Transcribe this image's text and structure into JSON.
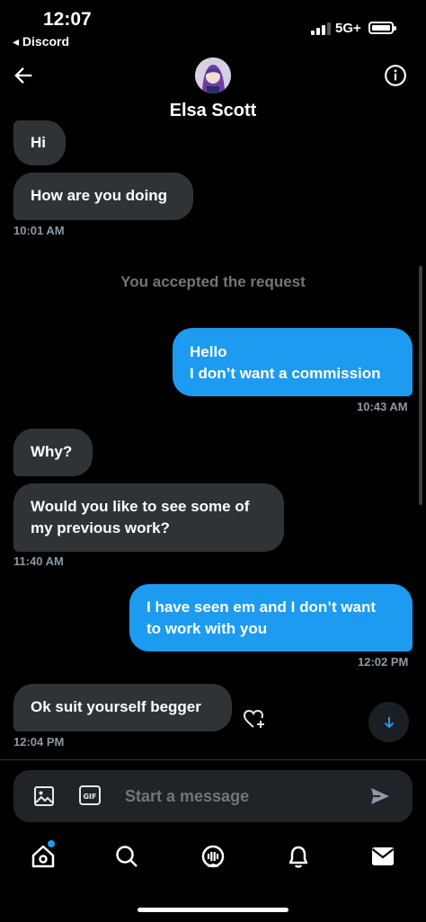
{
  "status_bar": {
    "time": "12:07",
    "back_app": "◂ Discord",
    "network": "5G+"
  },
  "header": {
    "contact_name": "Elsa Scott",
    "back_icon": "arrow-left-icon",
    "info_icon": "info-circle-icon"
  },
  "messages": [
    {
      "direction": "in",
      "text": "Hi"
    },
    {
      "direction": "in",
      "text": "How are you doing",
      "time": "10:01 AM"
    },
    {
      "direction": "system",
      "text": "You accepted the request"
    },
    {
      "direction": "out",
      "lines": [
        "Hello",
        "I don’t want a commission"
      ],
      "time": "10:43 AM"
    },
    {
      "direction": "in",
      "text": "Why?"
    },
    {
      "direction": "in",
      "lines": [
        "Would you like to see some of",
        "my previous work?"
      ],
      "time": "11:40 AM"
    },
    {
      "direction": "out",
      "lines": [
        "I have seen em and I don’t want",
        "to work with you"
      ],
      "time": "12:02 PM"
    },
    {
      "direction": "in",
      "text": "Ok suit yourself begger",
      "time": "12:04 PM"
    }
  ],
  "composer": {
    "placeholder": "Start a message",
    "icons": [
      "image-icon",
      "gif-icon",
      "send-icon"
    ]
  },
  "tabbar": {
    "icons": [
      "home-icon",
      "search-icon",
      "spaces-icon",
      "notifications-icon",
      "messages-icon"
    ],
    "home_has_badge": true
  },
  "colors": {
    "background": "#000000",
    "incoming_bubble": "#2f3336",
    "outgoing_bubble": "#1d9bf0",
    "muted_text": "#71767b"
  }
}
